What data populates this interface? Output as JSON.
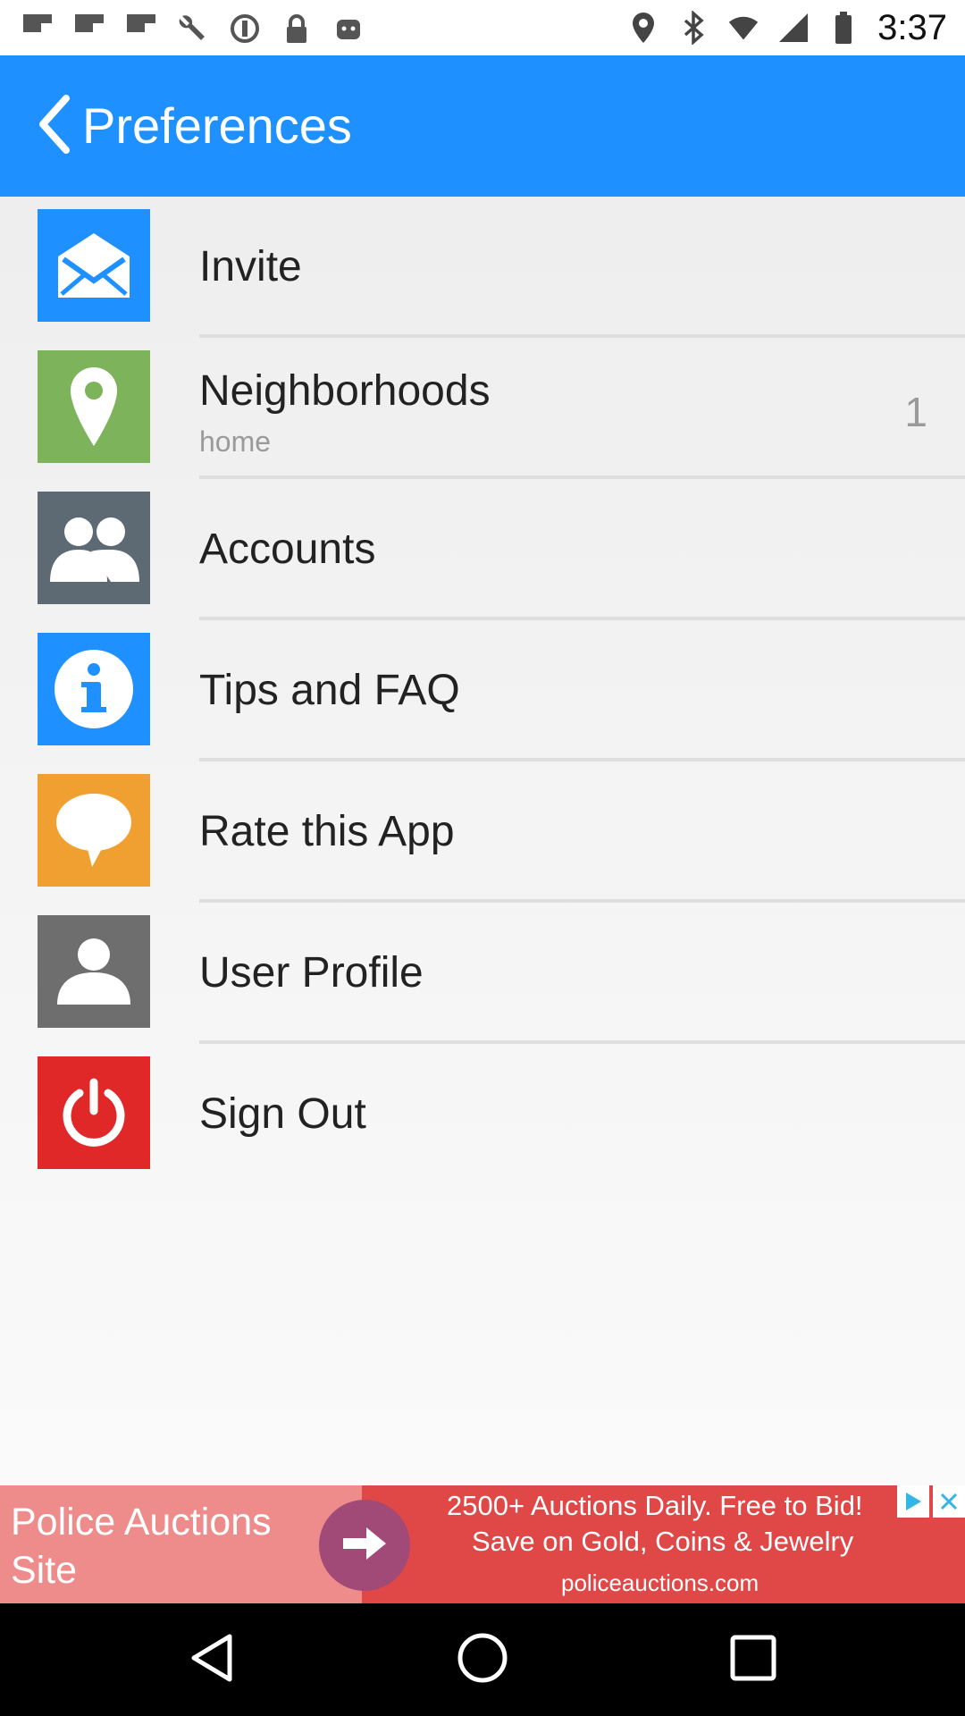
{
  "status_bar": {
    "time": "3:37",
    "left_icons": [
      "flipboard-icon",
      "flipboard-icon",
      "flipboard-icon",
      "wrench-icon",
      "circle-target-icon",
      "lock-icon",
      "android-icon"
    ],
    "right_icons": [
      "location-icon",
      "bluetooth-icon",
      "wifi-icon",
      "signal-icon",
      "battery-icon"
    ]
  },
  "app_bar": {
    "title": "Preferences",
    "color": "#1e90ff"
  },
  "menu": {
    "items": [
      {
        "label": "Invite",
        "icon": "envelope-icon",
        "color": "#1e90ff"
      },
      {
        "label": "Neighborhoods",
        "subtitle": "home",
        "count": "1",
        "icon": "map-pin-icon",
        "color": "#7db35a"
      },
      {
        "label": "Accounts",
        "icon": "people-icon",
        "color": "#5e6a73"
      },
      {
        "label": "Tips and FAQ",
        "icon": "info-icon",
        "color": "#1e90ff"
      },
      {
        "label": "Rate this App",
        "icon": "speech-bubble-icon",
        "color": "#f0a030"
      },
      {
        "label": "User Profile",
        "icon": "person-icon",
        "color": "#6e6e6e"
      },
      {
        "label": "Sign Out",
        "icon": "power-icon",
        "color": "#e02828"
      }
    ]
  },
  "ad": {
    "title": "Police Auctions Site",
    "line1": "2500+ Auctions Daily. Free to Bid!",
    "line2": "Save on Gold, Coins & Jewelry",
    "url": "policeauctions.com"
  }
}
